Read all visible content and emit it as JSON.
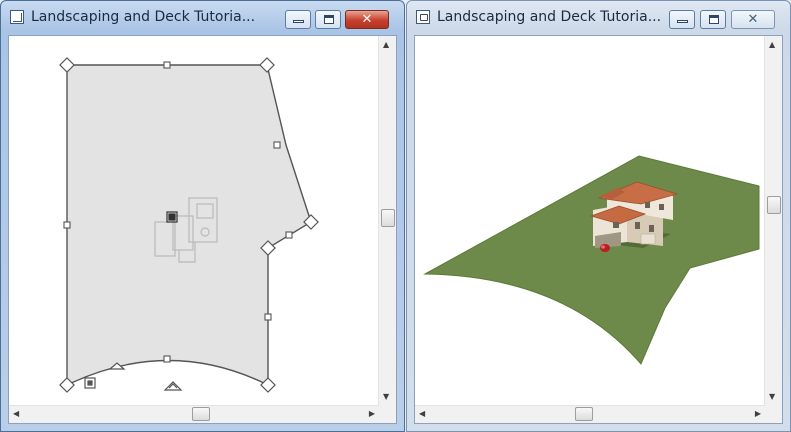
{
  "left_window": {
    "title": "Landscaping and Deck Tutoria...",
    "icon": "plan-view-icon",
    "buttons": {
      "minimize": "minimize-icon",
      "maximize": "maximize-icon",
      "close": "✕"
    }
  },
  "right_window": {
    "title": "Landscaping and Deck Tutoria...",
    "icon": "camera-view-icon",
    "buttons": {
      "minimize": "minimize-icon",
      "maximize": "maximize-icon",
      "close": "✕"
    }
  },
  "colors": {
    "terrain": "#6e8a4a",
    "terrain_edge": "#5d7a3a",
    "plan_fill": "#e3e3e3",
    "plan_outline": "#555555",
    "close_button_active": "#c6402d"
  }
}
